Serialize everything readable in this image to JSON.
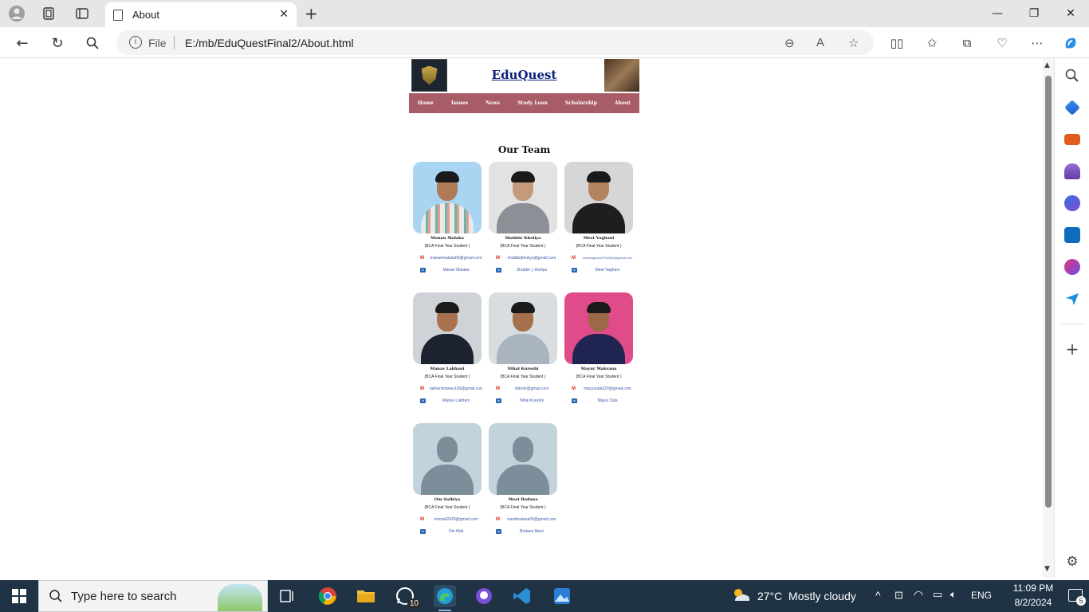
{
  "browser": {
    "tab_title": "About",
    "address_scheme": "File",
    "address_url": "E:/mb/EduQuestFinal2/About.html"
  },
  "site": {
    "title": "EduQuest",
    "nav": [
      "Home",
      "Issues",
      "News",
      "Study Loan",
      "Scholarship",
      "About"
    ],
    "team_heading": "Our Team",
    "members": [
      {
        "name": "Manan Malaka",
        "role": "(BCA Final Year Student )",
        "email": "mananmalaka06@gmail.com",
        "linkedin": "Manan Malaka"
      },
      {
        "name": "Shabbir Kholiya",
        "role": "(BCA Final Year Student )",
        "email": "shabbirjkholiya@gmail.com",
        "linkedin": "Shabbir j. kholiya"
      },
      {
        "name": "Meet Vaghani",
        "role": "(BCA Final Year Student )",
        "email": "meetvaghani27%2064@gmail.com",
        "linkedin": "Meet Vaghani"
      },
      {
        "name": "Manav Lakhani",
        "role": "(BCA Final Year Student )",
        "email": "lakhanimanav126@gmail.com",
        "linkedin": "Manav Lakhani"
      },
      {
        "name": "Nihal Kureshi",
        "role": "(BCA Final Year Student )",
        "email": "nhkrsh@gmail.com",
        "linkedin": "Nihal Kureshi"
      },
      {
        "name": "Mayur Makvana",
        "role": "(BCA Final Year Student )",
        "email": "mayurzala220@gmail.com",
        "linkedin": "Mayur Zala"
      },
      {
        "name": "Om Sathiya",
        "role": "(BCA Final Year Student )",
        "email": "ommali2428@gmail.com",
        "linkedin": "Om Mali"
      },
      {
        "name": "Meet Bodana",
        "role": "(BCA Final Year Student )",
        "email": "meetbodana05@gmail.com",
        "linkedin": "Bodana Meet"
      }
    ]
  },
  "taskbar": {
    "search_placeholder": "Type here to search",
    "whatsapp_badge": "10",
    "weather": "27°C  Mostly cloudy",
    "language": "ENG",
    "time": "11:09 PM",
    "date": "8/2/2024",
    "notification_count": "5"
  },
  "colors": {
    "nav_bg": "#a85c66",
    "site_title": "#0a1f7a",
    "taskbar_bg": "#1f3344"
  }
}
